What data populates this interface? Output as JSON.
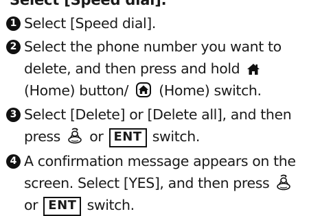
{
  "heading": {
    "text": "Select [Speed dial]."
  },
  "steps": [
    {
      "number": "1",
      "lines": [
        "Select [Speed dial]."
      ]
    },
    {
      "number": "2",
      "line1": "Select the phone number you want to",
      "line2_text": "delete, and then press and hold",
      "line3_a": "(Home) button/",
      "line3_b": "(Home) switch.",
      "icons": [
        "home-icon",
        "home-switch-icon"
      ]
    },
    {
      "number": "3",
      "line1": "Select [Delete] or [Delete all], and then",
      "line2_a": "press",
      "line2_or": "or",
      "line2_ent": "ENT",
      "line2_b": "switch.",
      "icons": [
        "selector-knob-icon"
      ]
    },
    {
      "number": "4",
      "line1": "A confirmation message appears on the",
      "line2": "screen. Select [YES], and then press",
      "line3_or": "or",
      "line3_ent": "ENT",
      "line3_b": "switch.",
      "icons": [
        "selector-knob-icon"
      ]
    }
  ]
}
